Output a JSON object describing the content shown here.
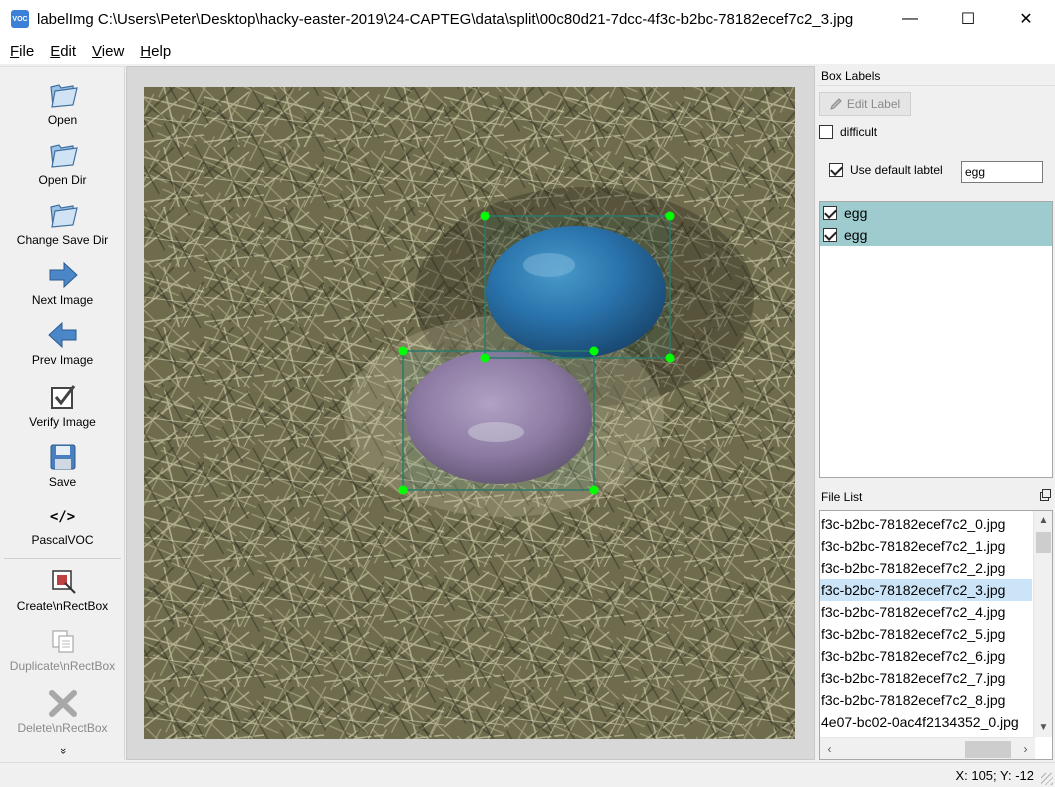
{
  "window": {
    "app_icon_text": "VOC",
    "title": "labelImg C:\\Users\\Peter\\Desktop\\hacky-easter-2019\\24-CAPTEG\\data\\split\\00c80d21-7dcc-4f3c-b2bc-78182ecef7c2_3.jpg",
    "minimize": "—",
    "maximize": "☐",
    "close": "✕"
  },
  "menu": {
    "file": {
      "mnemonic": "F",
      "rest": "ile"
    },
    "edit": {
      "mnemonic": "E",
      "rest": "dit"
    },
    "view": {
      "mnemonic": "V",
      "rest": "iew"
    },
    "help": {
      "mnemonic": "H",
      "rest": "elp"
    }
  },
  "toolbar": {
    "open": "Open",
    "open_dir": "Open Dir",
    "change_save_dir": "Change Save Dir",
    "next_image": "Next Image",
    "prev_image": "Prev Image",
    "verify_image": "Verify Image",
    "save": "Save",
    "format": "PascalVOC",
    "format_icon": "</>",
    "create_rectbox": "Create\\nRectBox",
    "duplicate_rectbox": "Duplicate\\nRectBox",
    "delete_rectbox": "Delete\\nRectBox",
    "more": "»"
  },
  "box_labels": {
    "title": "Box Labels",
    "edit_label_button": "Edit Label",
    "difficult_label": "difficult",
    "difficult_checked": false,
    "use_default_label": "Use default labtel",
    "use_default_checked": true,
    "default_label_value": "egg",
    "labels": [
      {
        "text": "egg",
        "checked": true
      },
      {
        "text": "egg",
        "checked": true
      }
    ]
  },
  "file_list": {
    "title": "File List",
    "files": [
      "f3c-b2bc-78182ecef7c2_0.jpg",
      "f3c-b2bc-78182ecef7c2_1.jpg",
      "f3c-b2bc-78182ecef7c2_2.jpg",
      "f3c-b2bc-78182ecef7c2_3.jpg",
      "f3c-b2bc-78182ecef7c2_4.jpg",
      "f3c-b2bc-78182ecef7c2_5.jpg",
      "f3c-b2bc-78182ecef7c2_6.jpg",
      "f3c-b2bc-78182ecef7c2_7.jpg",
      "f3c-b2bc-78182ecef7c2_8.jpg",
      "4e07-bc02-0ac4f2134352_0.jpg"
    ],
    "selected_index": 3
  },
  "status": {
    "coords": "X: 105; Y: -12"
  },
  "colors": {
    "label_row_bg": "#9dcbce",
    "selected_file_bg": "#cce4f7",
    "box_handle": "#00ff00",
    "box_outline": "#2a7a6a"
  }
}
